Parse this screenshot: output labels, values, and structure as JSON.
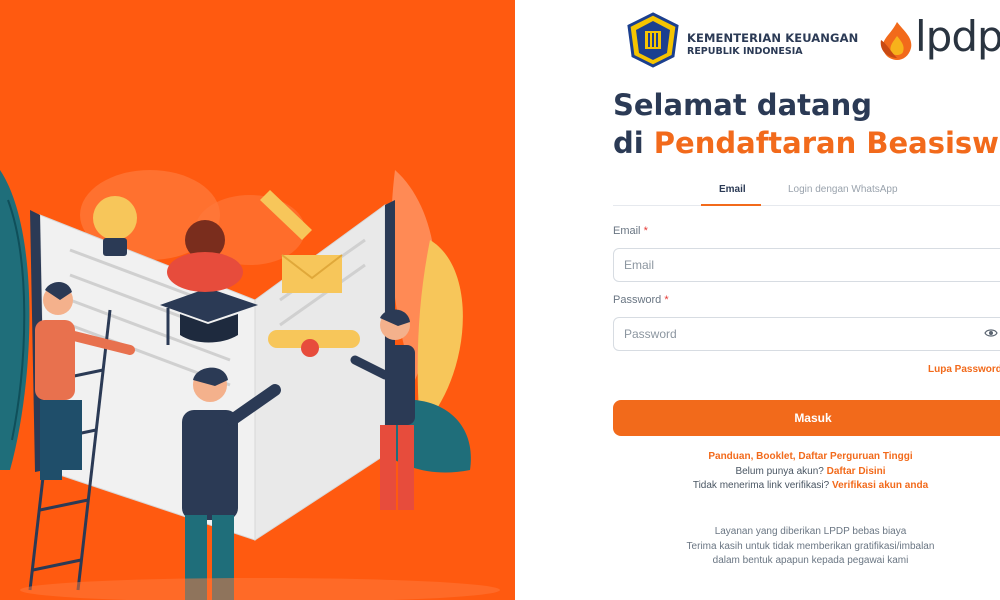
{
  "header": {
    "kemenkeu": {
      "line1": "KEMENTERIAN KEUANGAN",
      "line2": "REPUBLIK INDONESIA"
    },
    "lpdp": {
      "text": "lpdp"
    }
  },
  "welcome": {
    "line1": "Selamat datang",
    "line2_prefix": "di ",
    "line2_accent": "Pendaftaran Beasiswa"
  },
  "tabs": [
    {
      "label": "Email",
      "active": true
    },
    {
      "label": "Login dengan WhatsApp",
      "active": false
    }
  ],
  "form": {
    "email": {
      "label": "Email",
      "required_mark": "*",
      "placeholder": "Email",
      "value": ""
    },
    "password": {
      "label": "Password",
      "required_mark": "*",
      "placeholder": "Password",
      "value": ""
    },
    "forgot_label": "Lupa Password?",
    "submit_label": "Masuk"
  },
  "links": {
    "guides": "Panduan, Booklet, Daftar Perguruan Tinggi",
    "no_account_text": "Belum punya akun?",
    "register_link": "Daftar Disini",
    "no_link_text": "Tidak menerima link verifikasi?",
    "verify_link": "Verifikasi akun anda"
  },
  "footer": {
    "line1": "Layanan yang diberikan LPDP bebas biaya",
    "line2": "Terima kasih untuk tidak memberikan gratifikasi/imbalan",
    "line3": "dalam bentuk apapun kepada pegawai kami"
  },
  "colors": {
    "brand_orange": "#f26a1b",
    "left_panel_bg": "#ff5a10",
    "navy": "#2b3a55"
  }
}
